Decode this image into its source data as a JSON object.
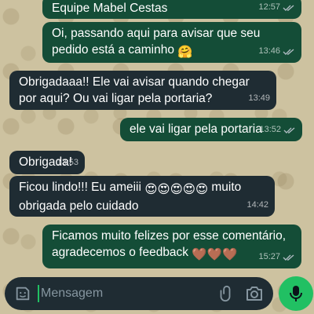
{
  "messages": [
    {
      "direction": "out",
      "text": "Equipe Mabel Cestas",
      "time": "12:57",
      "status": "read"
    },
    {
      "direction": "out",
      "text": "Oi, passando aqui para avisar que seu pedido está a caminho",
      "emoji": "🤗",
      "time": "13:46",
      "status": "read"
    },
    {
      "direction": "in",
      "text": "Obrigadaaa!! Ele vai avisar quando chegar por aqui? Ou vai ligar pela portaria?",
      "time": "13:49"
    },
    {
      "direction": "out",
      "text": "ele vai ligar pela portaria",
      "time": "13:52",
      "status": "read"
    },
    {
      "direction": "in",
      "text": "Obrigada!",
      "time": "13:53"
    },
    {
      "direction": "in",
      "text_before": "Ficou lindo!!! Eu ameiii",
      "emoji": "😍😍😍😍😍",
      "text_after": "muito obrigada pelo cuidado",
      "time": "14:42"
    },
    {
      "direction": "out",
      "text": "Ficamos muito felizes por esse comentário, agradecemos o feedback",
      "emoji": "🤎🤎🤎",
      "time": "15:27",
      "status": "read"
    }
  ],
  "composer": {
    "placeholder": "Mensagem"
  },
  "icons": {
    "sticker": "sticker-icon",
    "attach": "paperclip-icon",
    "camera": "camera-icon",
    "mic": "microphone-icon",
    "read_receipt": "double-check-icon"
  },
  "colors": {
    "outgoing_bubble": "#144d37",
    "incoming_bubble": "#1f2c33",
    "accent": "#21c063",
    "read_ticks": "#53bdeb"
  }
}
